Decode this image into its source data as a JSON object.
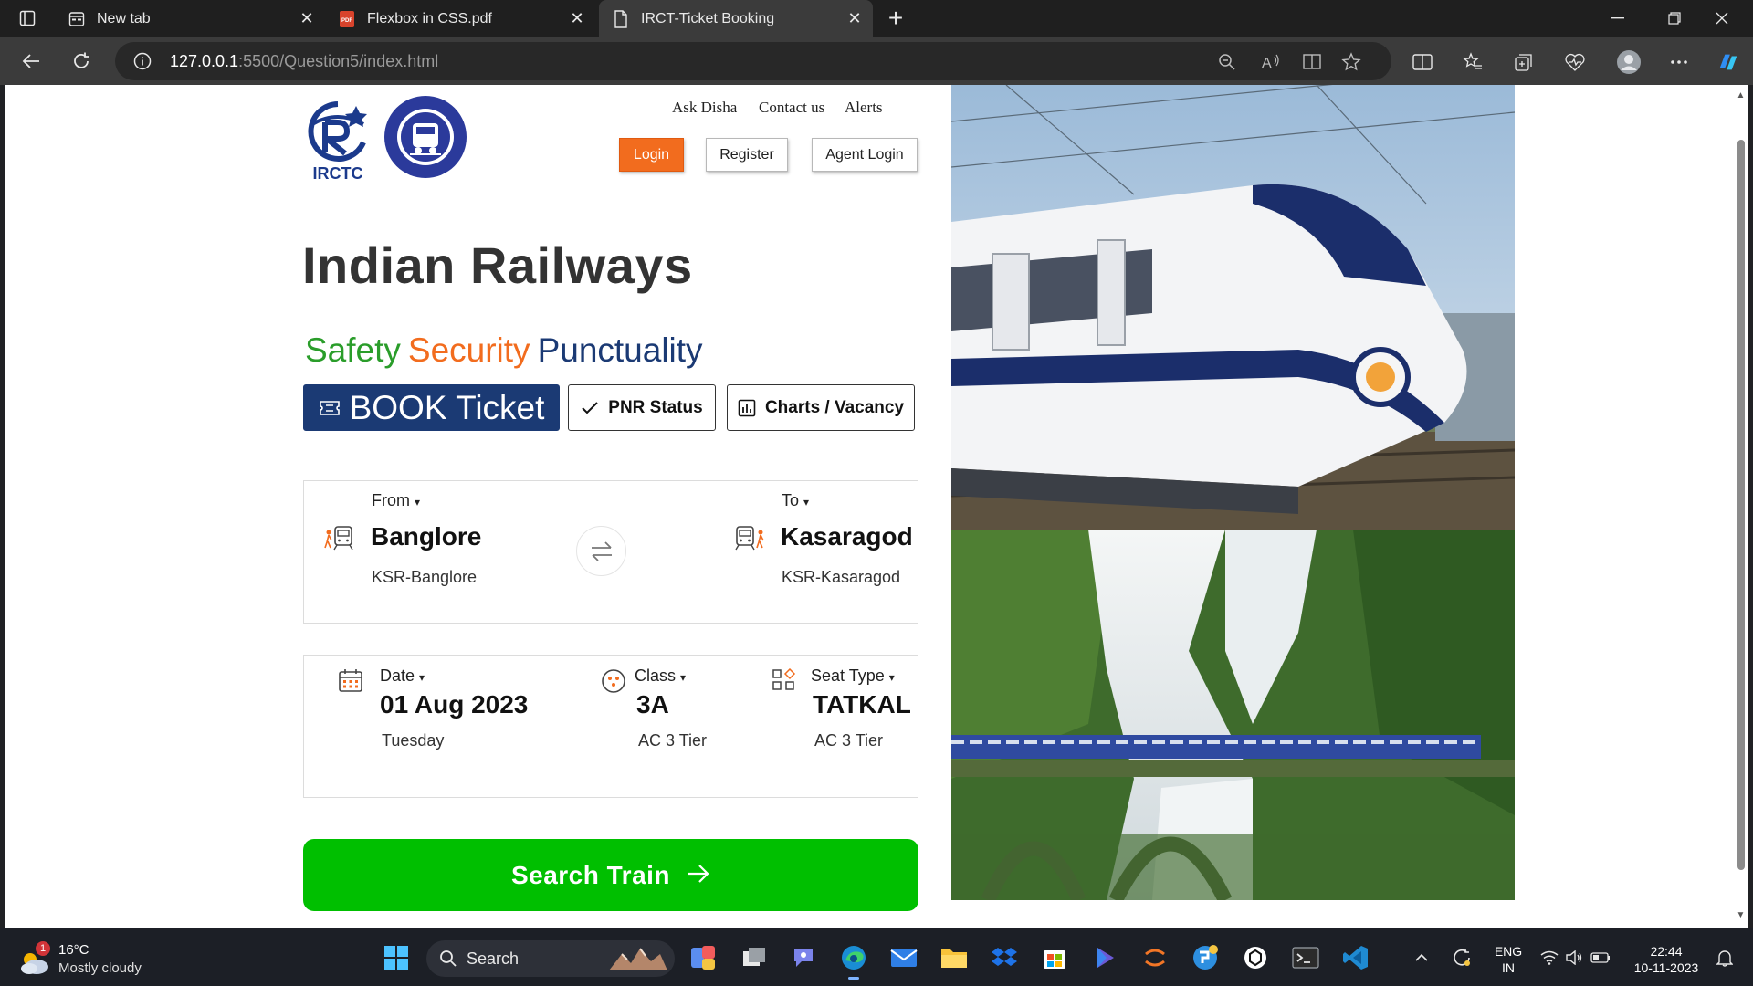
{
  "browser": {
    "tabs": [
      {
        "title": "New tab",
        "active": false
      },
      {
        "title": "Flexbox in CSS.pdf",
        "active": false
      },
      {
        "title": "IRCT-Ticket Booking",
        "active": true
      }
    ],
    "url_host": "127.0.0.1",
    "url_rest": ":5500/Question5/index.html"
  },
  "page": {
    "logos": {
      "irctc_text": "IRCTC",
      "ir_ring_text": "INDIAN RAILWAYS"
    },
    "top_links": [
      "Ask Disha",
      "Contact us",
      "Alerts"
    ],
    "auth": {
      "login": "Login",
      "register": "Register",
      "agent_login": "Agent Login"
    },
    "title": "Indian Railways",
    "tagline": [
      {
        "word": "Safety",
        "color": "#2a9d2a"
      },
      {
        "word": "Security",
        "color": "#f26c1e"
      },
      {
        "word": "Punctuality",
        "color": "#1b3a74"
      }
    ],
    "tab_buttons": {
      "book": "BOOK Ticket",
      "pnr": "PNR Status",
      "charts": "Charts / Vacancy"
    },
    "journey": {
      "from_label": "From",
      "from_city": "Banglore",
      "from_station": "KSR-Banglore",
      "to_label": "To",
      "to_city": "Kasaragod",
      "to_station": "KSR-Kasaragod"
    },
    "options": {
      "date_label": "Date",
      "date_value": "01 Aug 2023",
      "date_day": "Tuesday",
      "class_label": "Class",
      "class_value": "3A",
      "class_desc": "AC 3 Tier",
      "seat_label": "Seat Type",
      "seat_value": "TATKAL",
      "seat_desc": "AC 3 Tier"
    },
    "search_button": "Search Train"
  },
  "taskbar": {
    "weather_temp": "16°C",
    "weather_desc": "Mostly cloudy",
    "weather_badge": "1",
    "search_placeholder": "Search",
    "lang_top": "ENG",
    "lang_bottom": "IN",
    "time": "22:44",
    "date": "10-11-2023"
  },
  "colors": {
    "accent_orange": "#f26c1e",
    "navy": "#1b3a74",
    "green": "#00bf00"
  }
}
